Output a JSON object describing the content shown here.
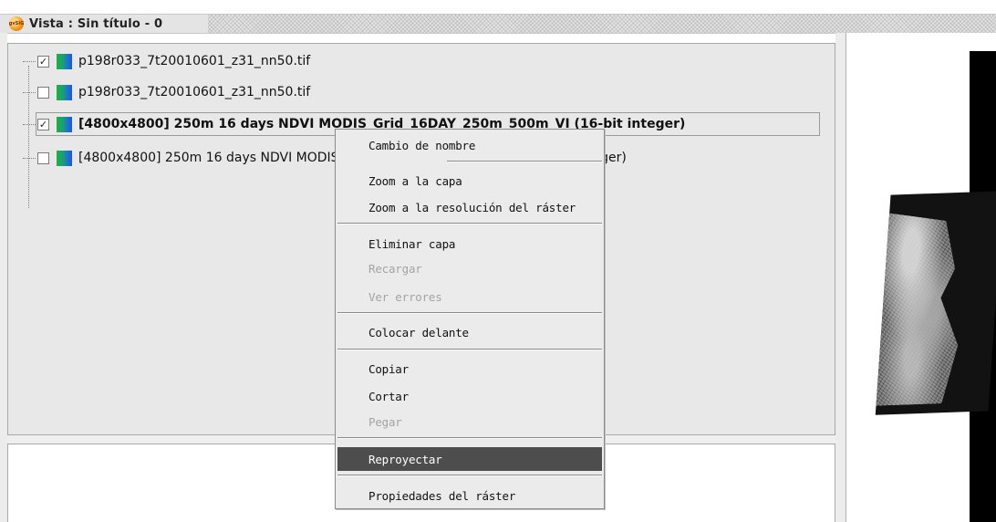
{
  "window": {
    "title": "Vista : Sin título - 0",
    "app_icon": "gvsig-sun-icon",
    "app_icon_text": "gvSIG"
  },
  "toc": {
    "layers": [
      {
        "label": "p198r033_7t20010601_z31_nn50.tif",
        "checked": true,
        "bold": false
      },
      {
        "label": "p198r033_7t20010601_z31_nn50.tif",
        "checked": false,
        "bold": false
      },
      {
        "label": "[4800x4800] 250m 16 days NDVI MODIS_Grid_16DAY_250m_500m_VI (16-bit integer)",
        "checked": true,
        "bold": true
      },
      {
        "label": "[4800x4800] 250m 16 days NDVI MODIS_Grid_16DAY_250m_500m_VI (16-bit integer)",
        "checked": false,
        "bold": false
      }
    ],
    "check_mark": "✓"
  },
  "context_menu": {
    "items": [
      {
        "label": "Cambio de nombre",
        "enabled": true
      },
      {
        "label": "Zoom a la capa",
        "enabled": true
      },
      {
        "label": "Zoom a la resolución del ráster",
        "enabled": true
      },
      {
        "label": "Eliminar capa",
        "enabled": true
      },
      {
        "label": "Recargar",
        "enabled": false
      },
      {
        "label": "Ver errores",
        "enabled": false
      },
      {
        "label": "Colocar delante",
        "enabled": true
      },
      {
        "label": "Copiar",
        "enabled": true
      },
      {
        "label": "Cortar",
        "enabled": true
      },
      {
        "label": "Pegar",
        "enabled": false
      },
      {
        "label": "Reproyectar",
        "enabled": true,
        "highlighted": true
      },
      {
        "label": "Propiedades del ráster",
        "enabled": true
      }
    ]
  },
  "colors": {
    "menu_highlight": "#4d4d4d",
    "panel_background": "#e8e8e8",
    "layer_icon_start": "#1bb33a",
    "layer_icon_end": "#1a52ff"
  }
}
